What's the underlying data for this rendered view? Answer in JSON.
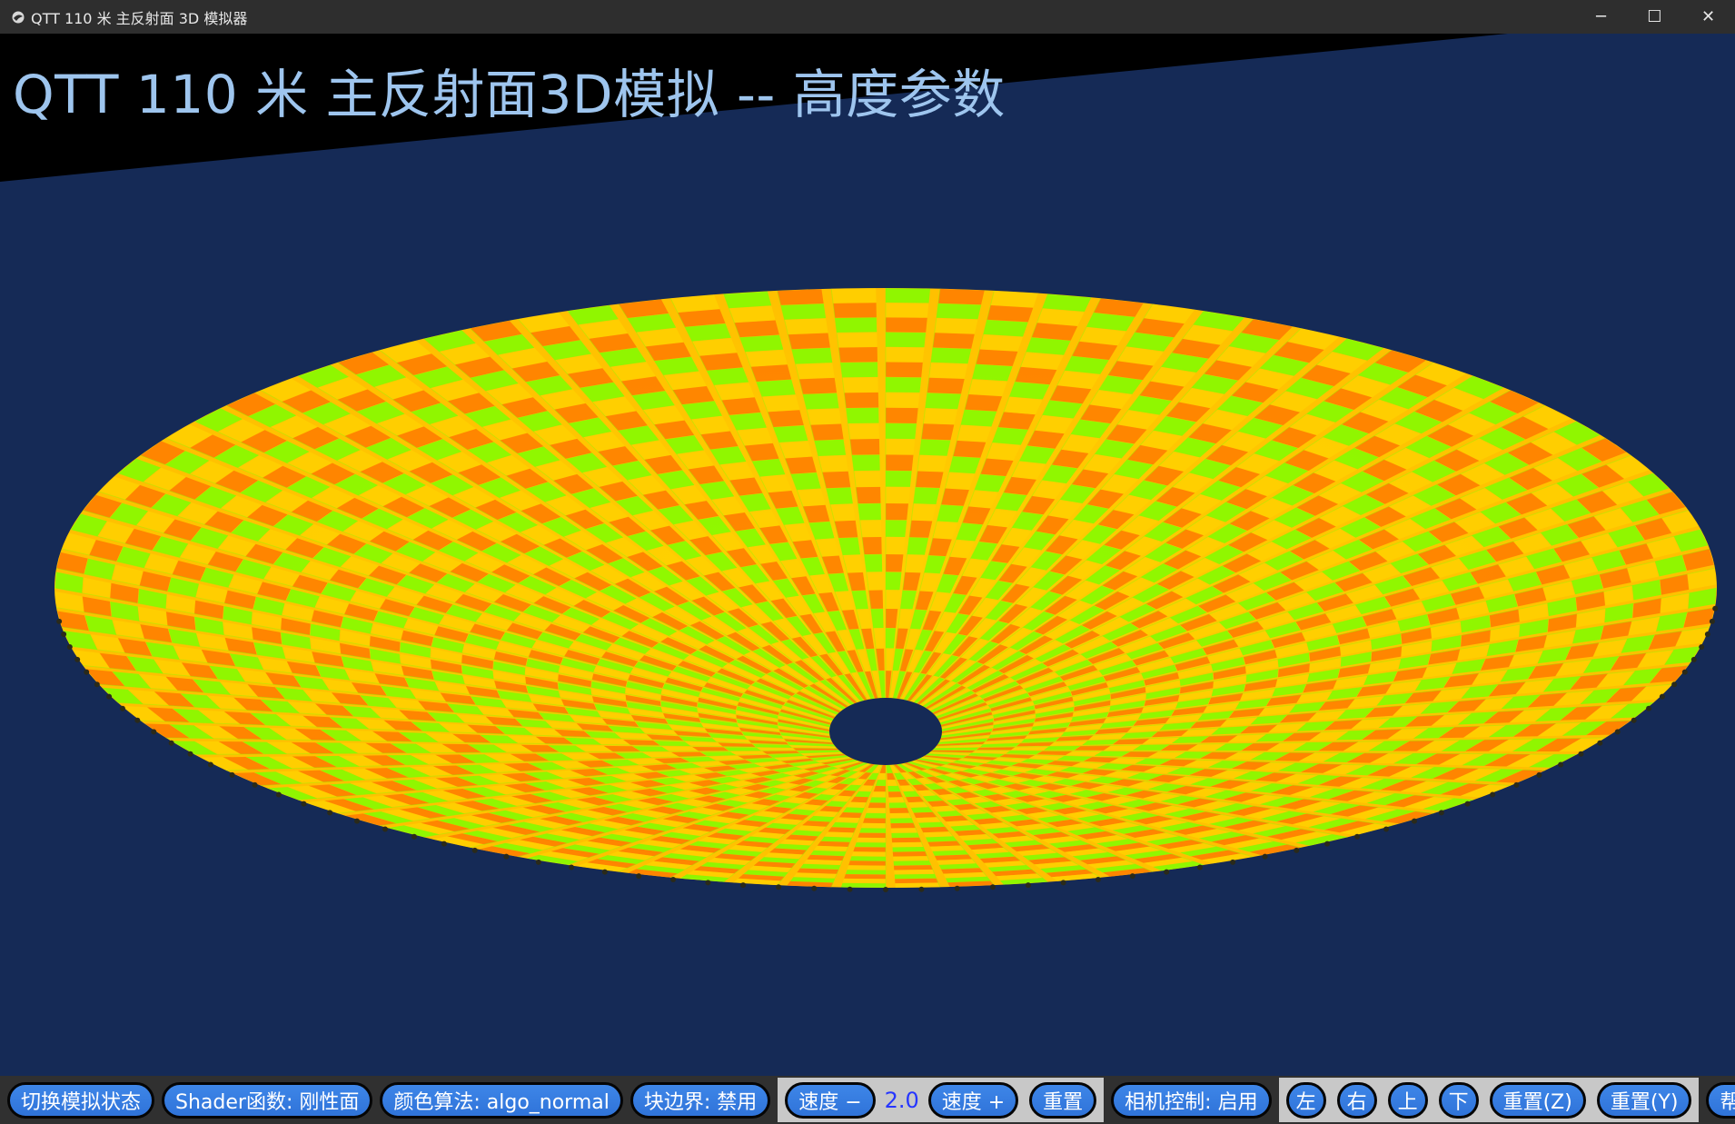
{
  "window": {
    "title": "QTT 110 米 主反射面 3D 模拟器",
    "icon": "app-icon",
    "controls": {
      "minimize": "─",
      "maximize": "☐",
      "close": "✕"
    }
  },
  "scene": {
    "title": "QTT 110 米 主反射面3D模拟 -- 高度参数",
    "background_color": "#152a56",
    "dish_colors": [
      "#ff7a00",
      "#ffd000",
      "#7cff00"
    ]
  },
  "toolbar": {
    "toggle_sim": "切换模拟状态",
    "shader": "Shader函数: 刚性面",
    "color_algo": "颜色算法: algo_normal",
    "block_border": "块边界: 禁用",
    "speed_minus": "速度 −",
    "speed_value": "2.0",
    "speed_plus": "速度 +",
    "reset": "重置",
    "camera_control": "相机控制: 启用",
    "left": "左",
    "right": "右",
    "up": "上",
    "down": "下",
    "reset_z": "重置(Z)",
    "reset_y": "重置(Y)",
    "help": "帮助"
  }
}
